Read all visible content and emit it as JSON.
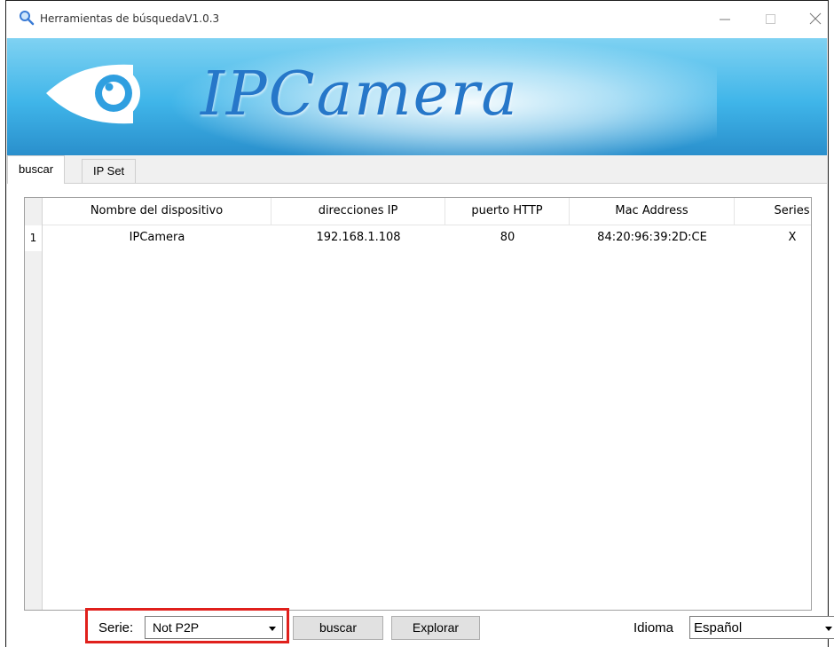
{
  "window": {
    "title": "Herramientas de búsquedaV1.0.3"
  },
  "banner": {
    "logo_text": "IPCamera"
  },
  "tabs": [
    {
      "label": "buscar",
      "active": true
    },
    {
      "label": "IP Set",
      "active": false
    }
  ],
  "table": {
    "columns": [
      "Nombre del dispositivo",
      "direcciones IP",
      "puerto HTTP",
      "Mac Address",
      "Series"
    ],
    "rows": [
      {
        "index": "1",
        "name": "IPCamera",
        "ip": "192.168.1.108",
        "port": "80",
        "mac": "84:20:96:39:2D:CE",
        "series": "X"
      }
    ]
  },
  "controls": {
    "serie_label": "Serie:",
    "serie_value": "Not P2P",
    "buscar_label": "buscar",
    "explorar_label": "Explorar",
    "idioma_label": "Idioma",
    "idioma_value": "Español"
  },
  "colors": {
    "highlight": "#e0201c",
    "banner_blue": "#3fb5e9",
    "icon_blue": "#3a7bd5"
  }
}
